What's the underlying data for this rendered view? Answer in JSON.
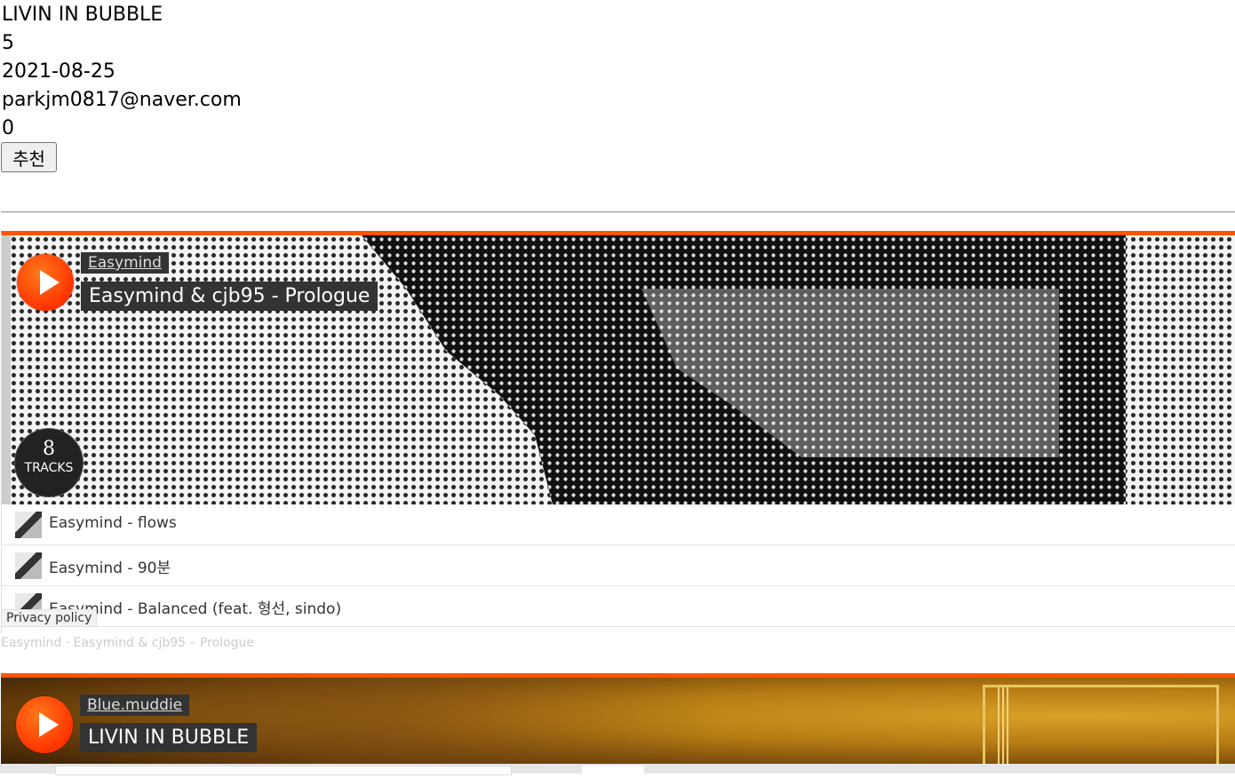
{
  "post": {
    "title": "LIVIN IN BUBBLE",
    "count": "5",
    "date": "2021-08-25",
    "email": "parkjm0817@naver.com",
    "votes": "0",
    "recommend_label": "추천"
  },
  "player1": {
    "user": "Easymind",
    "set_title": "Easymind & cjb95 - Prologue",
    "tracks_count": "8",
    "tracks_label": "TRACKS",
    "tracks": [
      {
        "name": "Easymind - flows"
      },
      {
        "name": "Easymind - 90분"
      },
      {
        "name": "Easymind - Balanced (feat. 형선, sindo)"
      }
    ],
    "privacy_label": "Privacy policy",
    "credit_user": "Easymind",
    "credit_sep": " · ",
    "credit_title": "Easymind & cjb95 – Prologue"
  },
  "player2": {
    "user": "Blue.muddie",
    "set_title": "LIVIN IN BUBBLE"
  },
  "colors": {
    "accent": "#ff5500",
    "label_bg": "#333333"
  },
  "icons": {
    "play": "play-icon",
    "track_thumb": "track-artwork"
  }
}
